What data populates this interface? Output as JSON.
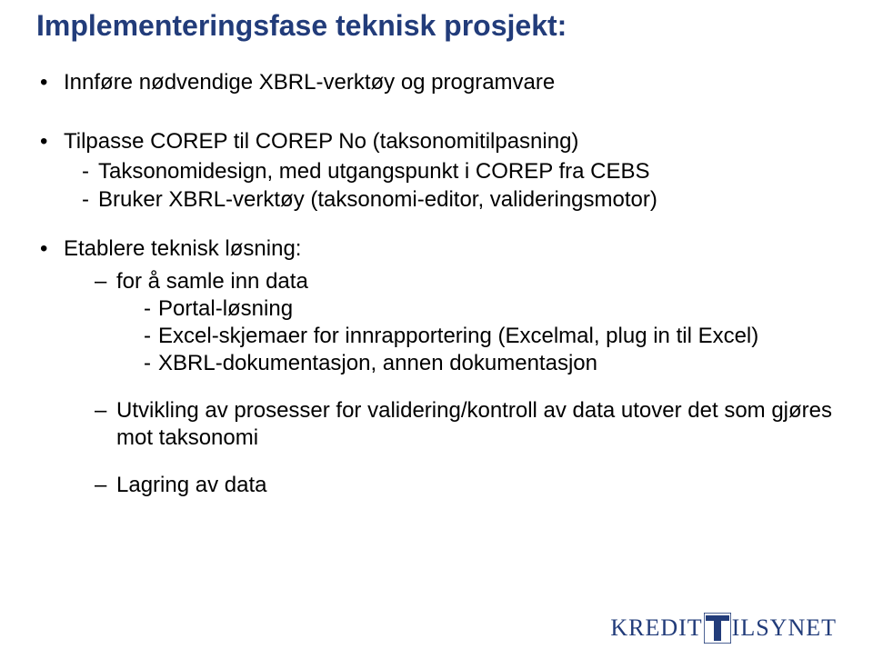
{
  "title": "Implementeringsfase teknisk prosjekt:",
  "bullets": {
    "b1": "Innføre nødvendige XBRL-verktøy og programvare",
    "b2_intro": "Tilpasse COREP til COREP No (taksonomitilpasning)",
    "b2_sub1": "Taksonomidesign, med utgangspunkt i COREP fra CEBS",
    "b2_sub2": "Bruker XBRL-verktøy (taksonomi-editor, valideringsmotor)",
    "b3": "Etablere teknisk løsning:",
    "b3_l2_1": "for å samle inn data",
    "b3_l2_1_s1": "Portal-løsning",
    "b3_l2_1_s2": "Excel-skjemaer for innrapportering (Excelmal, plug in til Excel)",
    "b3_l2_1_s3": "XBRL-dokumentasjon, annen dokumentasjon",
    "b3_l2_2": "Utvikling av prosesser for validering/kontroll av data utover det som gjøres mot taksonomi",
    "b3_l2_3": "Lagring av data"
  },
  "logo": {
    "left": "KREDIT",
    "right": "ILSYNET"
  }
}
